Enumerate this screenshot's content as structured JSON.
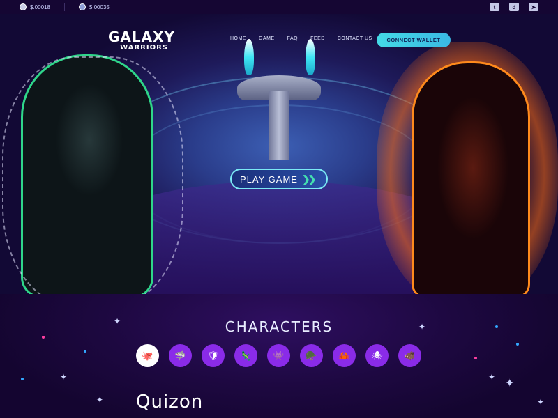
{
  "topbar": {
    "tokens": [
      {
        "icon": "coin-icon",
        "value": "$.00018"
      },
      {
        "icon": "coin-icon",
        "value": "$.00035"
      }
    ],
    "socials": [
      "twitter-icon",
      "discord-icon",
      "telegram-icon"
    ]
  },
  "header": {
    "logo_line1": "GALAXY",
    "logo_line2": "WARRIORS",
    "nav": [
      "HOME",
      "GAME",
      "FAQ",
      "FEED",
      "CONTACT US"
    ],
    "connect_label": "CONNECT WALLET"
  },
  "hero": {
    "play_label": "PLAY GAME",
    "play_icon": "double-chevron-icon"
  },
  "characters": {
    "title": "CHARACTERS",
    "items": [
      {
        "icon": "octopus-icon",
        "active": true
      },
      {
        "icon": "shark-icon",
        "active": false
      },
      {
        "icon": "shield-icon",
        "active": false
      },
      {
        "icon": "creature-icon",
        "active": false
      },
      {
        "icon": "alien-icon",
        "active": false
      },
      {
        "icon": "warrior-icon",
        "active": false
      },
      {
        "icon": "crab-icon",
        "active": false
      },
      {
        "icon": "spider-icon",
        "active": false
      },
      {
        "icon": "beast-icon",
        "active": false
      }
    ],
    "selected_name": "Quizon"
  },
  "colors": {
    "accent": "#44dae6",
    "character_bg": "#8a2be8",
    "page_bg": "#1a0838"
  }
}
